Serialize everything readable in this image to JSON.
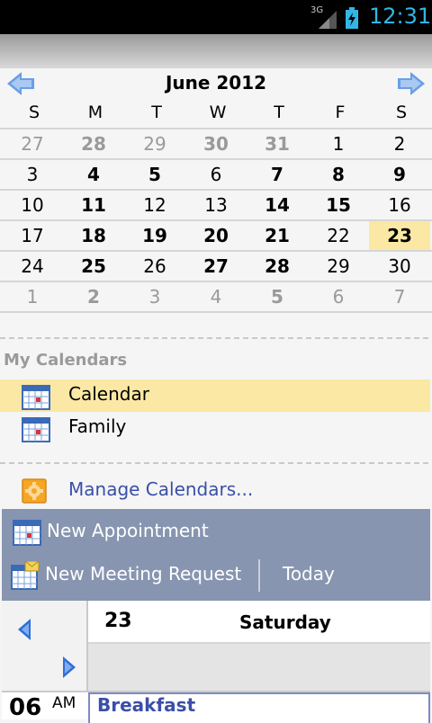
{
  "status": {
    "network": "3G",
    "time": "12:31"
  },
  "calendar": {
    "month_title": "June 2012",
    "weekdays": [
      "S",
      "M",
      "T",
      "W",
      "T",
      "F",
      "S"
    ],
    "weeks": [
      [
        {
          "d": "27",
          "t": "other"
        },
        {
          "d": "28",
          "t": "other",
          "b": true
        },
        {
          "d": "29",
          "t": "other"
        },
        {
          "d": "30",
          "t": "other",
          "b": true
        },
        {
          "d": "31",
          "t": "other",
          "b": true
        },
        {
          "d": "1",
          "t": "cur"
        },
        {
          "d": "2",
          "t": "cur"
        }
      ],
      [
        {
          "d": "3",
          "t": "cur"
        },
        {
          "d": "4",
          "t": "cur",
          "b": true
        },
        {
          "d": "5",
          "t": "cur",
          "b": true
        },
        {
          "d": "6",
          "t": "cur"
        },
        {
          "d": "7",
          "t": "cur",
          "b": true
        },
        {
          "d": "8",
          "t": "cur",
          "b": true
        },
        {
          "d": "9",
          "t": "cur",
          "b": true
        }
      ],
      [
        {
          "d": "10",
          "t": "cur"
        },
        {
          "d": "11",
          "t": "cur",
          "b": true
        },
        {
          "d": "12",
          "t": "cur"
        },
        {
          "d": "13",
          "t": "cur"
        },
        {
          "d": "14",
          "t": "cur",
          "b": true
        },
        {
          "d": "15",
          "t": "cur",
          "b": true
        },
        {
          "d": "16",
          "t": "cur"
        }
      ],
      [
        {
          "d": "17",
          "t": "cur"
        },
        {
          "d": "18",
          "t": "cur",
          "b": true
        },
        {
          "d": "19",
          "t": "cur",
          "b": true
        },
        {
          "d": "20",
          "t": "cur",
          "b": true
        },
        {
          "d": "21",
          "t": "cur",
          "b": true
        },
        {
          "d": "22",
          "t": "cur"
        },
        {
          "d": "23",
          "t": "cur",
          "b": true,
          "today": true
        }
      ],
      [
        {
          "d": "24",
          "t": "cur"
        },
        {
          "d": "25",
          "t": "cur",
          "b": true
        },
        {
          "d": "26",
          "t": "cur"
        },
        {
          "d": "27",
          "t": "cur",
          "b": true
        },
        {
          "d": "28",
          "t": "cur",
          "b": true
        },
        {
          "d": "29",
          "t": "cur"
        },
        {
          "d": "30",
          "t": "cur"
        }
      ],
      [
        {
          "d": "1",
          "t": "other"
        },
        {
          "d": "2",
          "t": "other",
          "b": true
        },
        {
          "d": "3",
          "t": "other"
        },
        {
          "d": "4",
          "t": "other"
        },
        {
          "d": "5",
          "t": "other",
          "b": true
        },
        {
          "d": "6",
          "t": "other"
        },
        {
          "d": "7",
          "t": "other"
        }
      ]
    ]
  },
  "my_calendars": {
    "title": "My Calendars",
    "items": [
      {
        "label": "Calendar",
        "selected": true
      },
      {
        "label": "Family",
        "selected": false
      }
    ],
    "manage_label": "Manage Calendars..."
  },
  "actions": {
    "new_appointment": "New Appointment",
    "new_meeting": "New Meeting Request",
    "today": "Today"
  },
  "day_view": {
    "day_number": "23",
    "day_name": "Saturday",
    "hour": "06",
    "ampm": "AM",
    "event_title": "Breakfast"
  },
  "colors": {
    "highlight": "#fae8a4",
    "link": "#3a4fa8",
    "action_bar": "#8795b0",
    "status_accent": "#33b5e5"
  }
}
